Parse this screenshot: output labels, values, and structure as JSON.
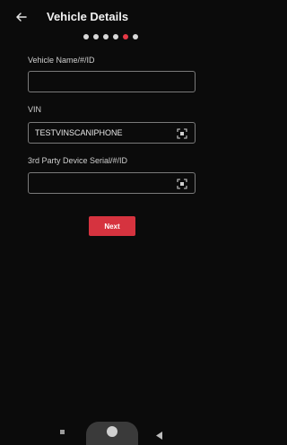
{
  "header": {
    "title": "Vehicle Details",
    "back_icon": "arrow-left-icon",
    "steps_total": 6,
    "steps_active": 5
  },
  "form": {
    "vehicle_name": {
      "label": "Vehicle Name/#/ID",
      "value": ""
    },
    "vin": {
      "label": "VIN",
      "value": "TESTVINSCANIPHONE",
      "scan_icon": "barcode-scan-icon"
    },
    "device_serial": {
      "label": "3rd Party Device Serial/#/ID",
      "value": "",
      "scan_icon": "barcode-scan-icon"
    }
  },
  "actions": {
    "next_label": "Next"
  },
  "colors": {
    "accent": "#d6333f",
    "background": "#0b0b0b"
  },
  "system_nav": {
    "icons": [
      "recent-apps-icon",
      "home-icon",
      "back-icon"
    ]
  }
}
